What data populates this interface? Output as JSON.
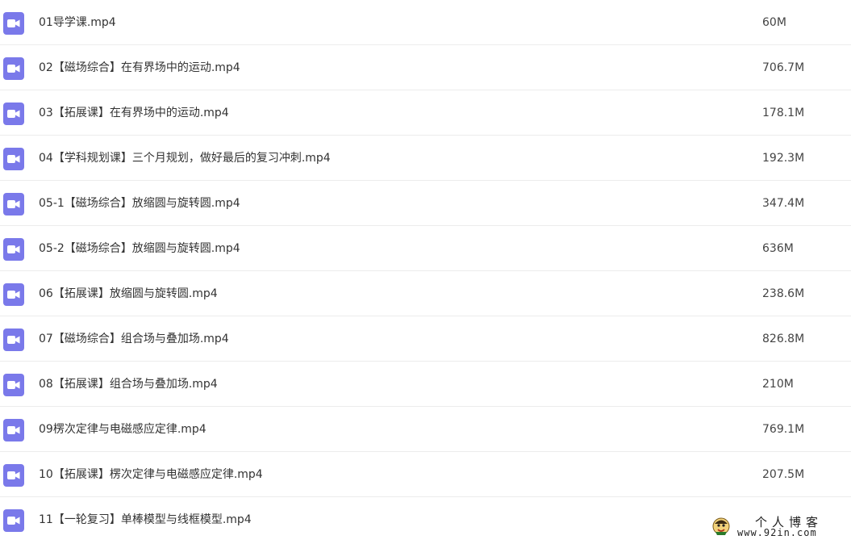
{
  "files": [
    {
      "name": "01导学课.mp4",
      "size": "60M",
      "icon": "video-file-icon"
    },
    {
      "name": "02【磁场综合】在有界场中的运动.mp4",
      "size": "706.7M",
      "icon": "video-file-icon"
    },
    {
      "name": "03【拓展课】在有界场中的运动.mp4",
      "size": "178.1M",
      "icon": "video-file-icon"
    },
    {
      "name": "04【学科规划课】三个月规划，做好最后的复习冲刺.mp4",
      "size": "192.3M",
      "icon": "video-file-icon"
    },
    {
      "name": "05-1【磁场综合】放缩圆与旋转圆.mp4",
      "size": "347.4M",
      "icon": "video-file-icon"
    },
    {
      "name": "05-2【磁场综合】放缩圆与旋转圆.mp4",
      "size": "636M",
      "icon": "video-file-icon"
    },
    {
      "name": "06【拓展课】放缩圆与旋转圆.mp4",
      "size": "238.6M",
      "icon": "video-file-icon"
    },
    {
      "name": "07【磁场综合】组合场与叠加场.mp4",
      "size": "826.8M",
      "icon": "video-file-icon"
    },
    {
      "name": "08【拓展课】组合场与叠加场.mp4",
      "size": "210M",
      "icon": "video-file-icon"
    },
    {
      "name": "09楞次定律与电磁感应定律.mp4",
      "size": "769.1M",
      "icon": "video-file-icon"
    },
    {
      "name": "10【拓展课】楞次定律与电磁感应定律.mp4",
      "size": "207.5M",
      "icon": "video-file-icon"
    },
    {
      "name": "11【一轮复习】单棒模型与线框模型.mp4",
      "size": "",
      "icon": "video-file-icon"
    }
  ],
  "colors": {
    "icon_bg": "#7a79ea",
    "divider": "#ececec",
    "text": "#333333"
  },
  "watermark": {
    "title": "个人博客",
    "url": "www.92in.com"
  }
}
